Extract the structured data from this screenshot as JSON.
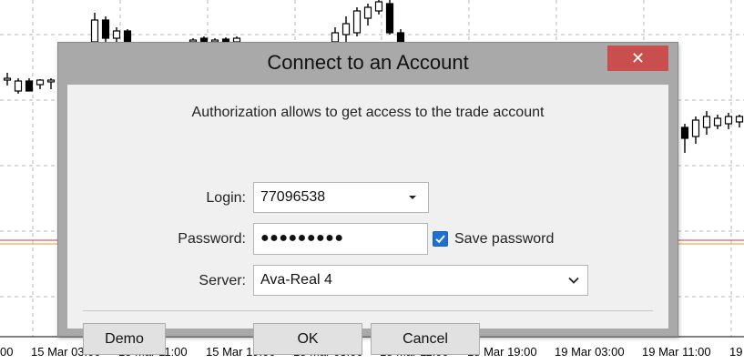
{
  "dialog": {
    "title": "Connect to an Account",
    "close_label": "✕",
    "info_text": "Authorization allows to get access to the trade account",
    "login": {
      "label": "Login:",
      "value": "77096538"
    },
    "password": {
      "label": "Password:",
      "value": "●●●●●●●●●"
    },
    "save_password": {
      "label": "Save password",
      "checked": true
    },
    "server": {
      "label": "Server:",
      "value": "Ava-Real 4"
    },
    "buttons": {
      "demo": "Demo",
      "ok": "OK",
      "cancel": "Cancel"
    }
  },
  "chart": {
    "time_labels": [
      "15 Mar 03:00",
      "15 Mar 11:00",
      "15 Mar 19:00",
      "18 Mar 03:00",
      "18 Mar 11:00",
      "18 Mar 19:00",
      "19 Mar 03:00",
      "19 Mar 11:00"
    ],
    "left_cut_label": "00",
    "right_cut_label": "19",
    "colors": {
      "grid": "#b8b8b8",
      "candle": "#000000",
      "price_line_red": "#d23c3c",
      "price_line_orange": "#e39b2d"
    }
  }
}
